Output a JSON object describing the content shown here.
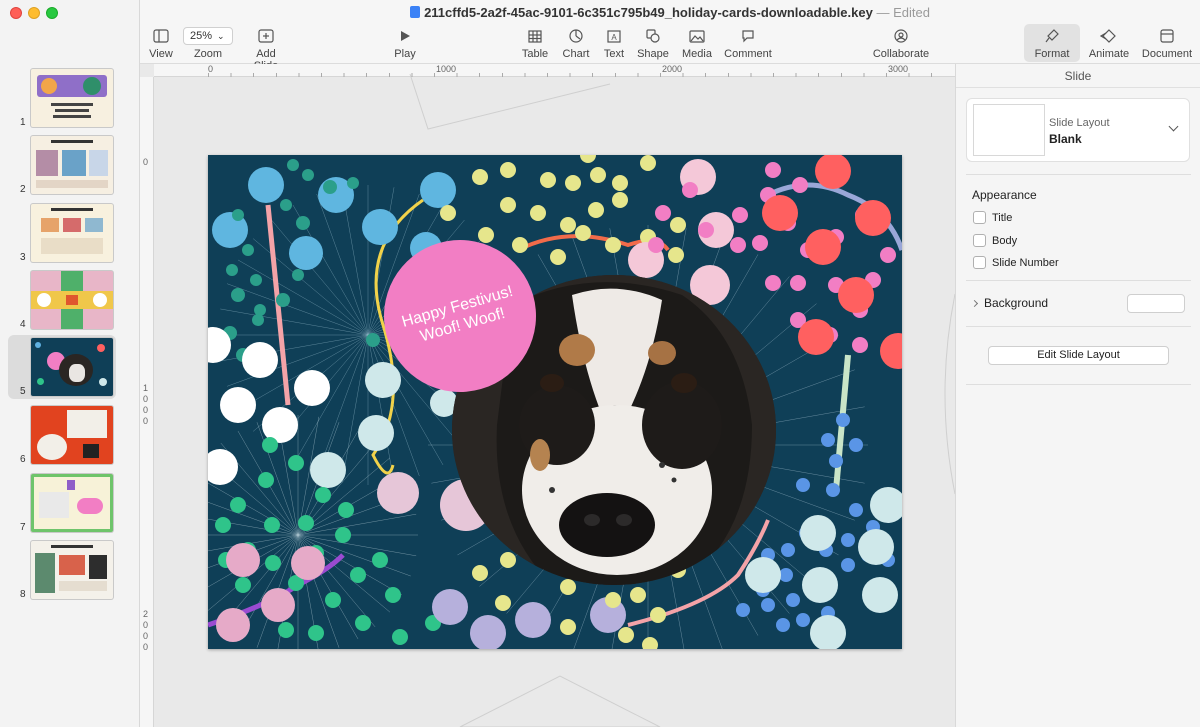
{
  "window": {
    "title": "211cffd5-2a2f-45ac-9101-6c351c795b49_holiday-cards-downloadable.key",
    "separator": "—",
    "status": "Edited"
  },
  "toolbar": {
    "view": "View",
    "zoom_label": "Zoom",
    "zoom_value": "25%",
    "add_slide": "Add Slide",
    "play": "Play",
    "table": "Table",
    "chart": "Chart",
    "text": "Text",
    "shape": "Shape",
    "media": "Media",
    "comment": "Comment",
    "collaborate": "Collaborate",
    "format": "Format",
    "animate": "Animate",
    "document": "Document"
  },
  "ruler": {
    "h": [
      "0",
      "1000",
      "2000",
      "3000"
    ],
    "v": [
      "0",
      "1\n0\n0\n0",
      "2\n0\n0\n0"
    ]
  },
  "navigator": {
    "slides": [
      {
        "num": "1",
        "caption": "Choose a card.\nMake it yours.\nSend with cheer."
      },
      {
        "num": "2",
        "caption": "How to Keynote"
      },
      {
        "num": "3",
        "caption": "Design it your way"
      },
      {
        "num": "4",
        "caption": ""
      },
      {
        "num": "5",
        "caption": ""
      },
      {
        "num": "6",
        "caption": ""
      },
      {
        "num": "7",
        "caption": ""
      },
      {
        "num": "8",
        "caption": "Extra Inspiration"
      }
    ],
    "selected": "5"
  },
  "slide": {
    "greeting_line1": "Happy Festivus!",
    "greeting_line2": "Woof! Woof!",
    "background_color": "#0f3f57",
    "bubble_color": "#f27ec4"
  },
  "inspector": {
    "heading": "Slide",
    "layout_label": "Slide Layout",
    "layout_value": "Blank",
    "appearance": "Appearance",
    "checks": [
      "Title",
      "Body",
      "Slide Number"
    ],
    "background": "Background",
    "edit_layout": "Edit Slide Layout"
  }
}
